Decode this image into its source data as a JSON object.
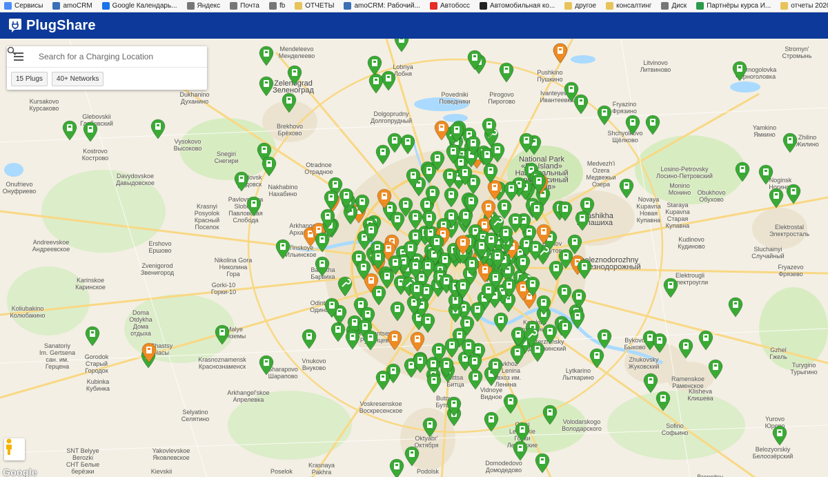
{
  "bookmarks": [
    {
      "label": "Сервисы",
      "color": "#4c8bf5"
    },
    {
      "label": "amoCRM",
      "color": "#3b6fb6"
    },
    {
      "label": "Google Календарь...",
      "color": "#1a73e8"
    },
    {
      "label": "Яндекс",
      "color": "#777777"
    },
    {
      "label": "Почта",
      "color": "#777777"
    },
    {
      "label": "fb",
      "color": "#777777"
    },
    {
      "label": "ОТЧЕТЫ",
      "color": "#e8c35a"
    },
    {
      "label": "amoCRM: Рабочий...",
      "color": "#3b6fb6"
    },
    {
      "label": "Автобосс",
      "color": "#e52d27"
    },
    {
      "label": "Автомобильная ко...",
      "color": "#222222"
    },
    {
      "label": "другое",
      "color": "#e8c35a"
    },
    {
      "label": "консалтинг",
      "color": "#e8c35a"
    },
    {
      "label": "Диск",
      "color": "#777777"
    },
    {
      "label": "Партнёры курса И...",
      "color": "#2a9a4a"
    },
    {
      "label": "отчеты 2020",
      "color": "#e8c35a"
    }
  ],
  "header": {
    "logo_text": "PlugShare",
    "background": "#0d3a9a"
  },
  "search": {
    "placeholder": "Search for a Charging Location",
    "value": ""
  },
  "filters": {
    "plugs_label": "15 Plugs",
    "networks_label": "40+ Networks"
  },
  "attribution": {
    "google": "Google"
  },
  "colors": {
    "pin_green": "#3aaa35",
    "pin_orange": "#ef8b22",
    "water": "#aadaff",
    "park": "#cfe8b5",
    "urban": "#e8e0cc",
    "road_major": "#f9d884"
  },
  "places": [
    {
      "name": "Mendeleevo\nМенделеево"
    },
    {
      "name": "Zelenograd\nЗеленоград"
    },
    {
      "name": "Dukhanino\nДуханино"
    },
    {
      "name": "Kursakovo\nКурсаково"
    },
    {
      "name": "Glebovskii\nГлебовский"
    },
    {
      "name": "Kostrovo\nКострово"
    },
    {
      "name": "Vysokovo\nВысоково"
    },
    {
      "name": "Snegiri\nСнегири"
    },
    {
      "name": "Brekhovo\nБрёхово"
    },
    {
      "name": "Lobnya\nЛобня"
    },
    {
      "name": "Dolgoprudny\nДолгопрудный"
    },
    {
      "name": "Povedniki\nПоведники"
    },
    {
      "name": "Pirogovo\nПирогово"
    },
    {
      "name": "Pushkino\nПушкино"
    },
    {
      "name": "Ivanteyevka\nИвантеевка"
    },
    {
      "name": "Fryazino\nФрязино"
    },
    {
      "name": "Shchyolkovo\nЩёлково"
    },
    {
      "name": "Litvinovo\nЛитвиново"
    },
    {
      "name": "Stromyn'\nСтромынь"
    },
    {
      "name": "Chernogolovka\nЧерноголовка"
    },
    {
      "name": "Yamkino\nЯмкино"
    },
    {
      "name": "Zhilino\nЖилино"
    },
    {
      "name": "National Park\n«Elk Island»\nНациональный\nпарк «Лосиный\nостров»"
    },
    {
      "name": "Medvezh'i\nOzera\nМедвежьи\nОзера"
    },
    {
      "name": "Losino-Petrovsky\nЛосино-Петровский"
    },
    {
      "name": "Monino\nМонино"
    },
    {
      "name": "Obukhovo\nОбухово"
    },
    {
      "name": "Noginsk\nНогинск"
    },
    {
      "name": "Novaya\nKupavna\nНовая\nКупавна"
    },
    {
      "name": "Staraya\nKupavna\nСтарая\nКупавна"
    },
    {
      "name": "Balashikha\nБалашиха"
    },
    {
      "name": "Elektrostal\nЭлектросталь"
    },
    {
      "name": "Kudinovo\nКудиново"
    },
    {
      "name": "Sluchainyi\nСлучайный"
    },
    {
      "name": "Fryazevo\nФрязево"
    },
    {
      "name": "Onufrievo\nОнуфриево"
    },
    {
      "name": "Davydovskoe\nДавыдовское"
    },
    {
      "name": "Dedovsk\nДедовск"
    },
    {
      "name": "Nakhabino\nНахабино"
    },
    {
      "name": "Otradnoe\nОтрадное"
    },
    {
      "name": "Pavlovskaya\nSloboda\nПавловская\nСлобода"
    },
    {
      "name": "Krasnyi\nPosyolok\nКрасный\nПоселок"
    },
    {
      "name": "Arkhangel'skoe\nАрхангельское"
    },
    {
      "name": "Andreevskoe\nАндреевское"
    },
    {
      "name": "Ershovo\nЕршово"
    },
    {
      "name": "Il'inskoye\nИльинское"
    },
    {
      "name": "Nikolina Gora\nНиколина\nГора"
    },
    {
      "name": "Zvenigorod\nЗвенигород"
    },
    {
      "name": "Barvikha\nБарвиха"
    },
    {
      "name": "Gorki-10\nГорки-10"
    },
    {
      "name": "Karinskoe\nКаринское"
    },
    {
      "name": "Reutov\nРеутов"
    },
    {
      "name": "Zheleznodorozhny\nЖелезнодорожный"
    },
    {
      "name": "Elektrougli\nЭлектроугли"
    },
    {
      "name": "Odintsovo\nОдинцово"
    },
    {
      "name": "Koliubakino\nКолюбакино"
    },
    {
      "name": "Doma\nOtdykha\nДома\nотдыха"
    },
    {
      "name": "Malye\nВяземы"
    },
    {
      "name": "Rumyantsevo\nРумянцево"
    },
    {
      "name": "Kotelniki\nКотельники"
    },
    {
      "name": "Dzerzhinsky\nДзержинский"
    },
    {
      "name": "Bykovo\nБыково"
    },
    {
      "name": "Zhukovsky\nЖуковский"
    },
    {
      "name": "Gzhel\nГжель"
    },
    {
      "name": "Turygino\nТурыгино"
    },
    {
      "name": "Sanatoriy\nIm. Gertsena\nсан. им.\nГерцена"
    },
    {
      "name": "Gorodok\nСтарый\nГородок"
    },
    {
      "name": "Chastsy\nЧасы"
    },
    {
      "name": "Krasnoznamensk\nКраснознаменск"
    },
    {
      "name": "Vnukovo\nВнуково"
    },
    {
      "name": "Sharapovo\nШарапово"
    },
    {
      "name": "Kubinka\nКубинка"
    },
    {
      "name": "Arkhangel'skoe\nАпрелевка"
    },
    {
      "name": "Sovkhoz\nIm. Lenina\nсовхоз им.\nЛенина"
    },
    {
      "name": "Bittsa\nБитца"
    },
    {
      "name": "Butovo\nБутово"
    },
    {
      "name": "Vidnoye\nВидное"
    },
    {
      "name": "Lytkarino\nЛыткарино"
    },
    {
      "name": "Ramenskoe\nРаменское"
    },
    {
      "name": "Klisheva\nКлишева"
    },
    {
      "name": "Voskresenskoe\nВоскресенское"
    },
    {
      "name": "Selyatino\nСелятино"
    },
    {
      "name": "Gorki\nLeninskie\nГорки\nЛенинские"
    },
    {
      "name": "Volodarskogo\nВолодарского"
    },
    {
      "name": "Sofino\nСофьино"
    },
    {
      "name": "Yurovo\nЮрово"
    },
    {
      "name": "Belozyorskiy\nБелоозёрский"
    },
    {
      "name": "SNT Belyye\nBerozki\nСНТ Белые\nберёзки"
    },
    {
      "name": "Yakovlevskoe\nЯковлевское"
    },
    {
      "name": "Oktyabr'\nОктября"
    },
    {
      "name": "Domodedovo\nДомодедово"
    },
    {
      "name": "Krasnaya\nPakhra\nКрасная\nПахра"
    },
    {
      "name": "Kievskii"
    },
    {
      "name": "Poselok"
    },
    {
      "name": "Podolsk"
    },
    {
      "name": "Bronnitsy"
    }
  ],
  "pins_summary": {
    "green_count": 318,
    "orange_count": 28,
    "wrench_count": 12
  }
}
